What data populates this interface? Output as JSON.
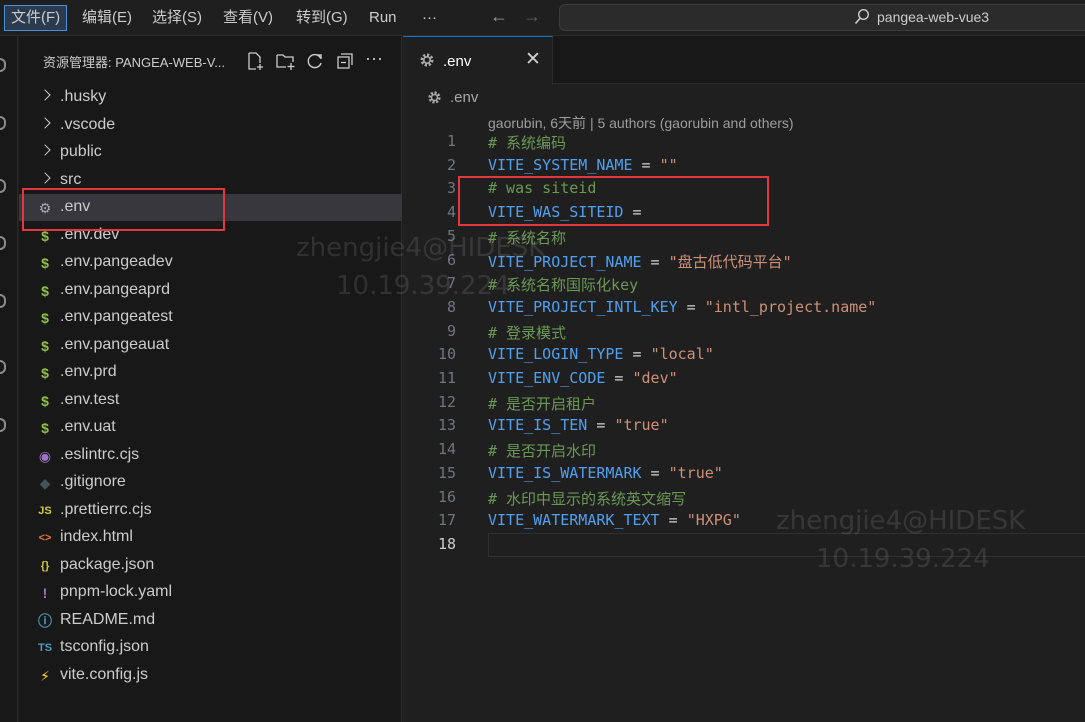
{
  "menu": {
    "file": "文件(F)",
    "edit": "编辑(E)",
    "selection": "选择(S)",
    "view": "查看(V)",
    "goto": "转到(G)",
    "run": "Run",
    "more": "···"
  },
  "search": {
    "text": "pangea-web-vue3"
  },
  "sidebar": {
    "title": "资源管理器: PANGEA-WEB-V...",
    "items": [
      {
        "label": ".husky",
        "type": "folder"
      },
      {
        "label": ".vscode",
        "type": "folder"
      },
      {
        "label": "public",
        "type": "folder"
      },
      {
        "label": "src",
        "type": "folder"
      },
      {
        "label": ".env",
        "type": "gear"
      },
      {
        "label": ".env.dev",
        "type": "dollar"
      },
      {
        "label": ".env.pangeadev",
        "type": "dollar"
      },
      {
        "label": ".env.pangeaprd",
        "type": "dollar"
      },
      {
        "label": ".env.pangeatest",
        "type": "dollar"
      },
      {
        "label": ".env.pangeauat",
        "type": "dollar"
      },
      {
        "label": ".env.prd",
        "type": "dollar"
      },
      {
        "label": ".env.test",
        "type": "dollar"
      },
      {
        "label": ".env.uat",
        "type": "dollar"
      },
      {
        "label": ".eslintrc.cjs",
        "type": "eslint"
      },
      {
        "label": ".gitignore",
        "type": "git"
      },
      {
        "label": ".prettierrc.cjs",
        "type": "js"
      },
      {
        "label": "index.html",
        "type": "html"
      },
      {
        "label": "package.json",
        "type": "json"
      },
      {
        "label": "pnpm-lock.yaml",
        "type": "yaml"
      },
      {
        "label": "README.md",
        "type": "info"
      },
      {
        "label": "tsconfig.json",
        "type": "ts"
      },
      {
        "label": "vite.config.js",
        "type": "vite"
      }
    ]
  },
  "editor": {
    "tab_label": ".env",
    "tab_close": "✕",
    "breadcrumb": ".env",
    "blame": "gaorubin, 6天前 | 5 authors (gaorubin and others)",
    "lines": [
      {
        "n": "1",
        "comment": "# 系统编码"
      },
      {
        "n": "2",
        "key": "VITE_SYSTEM_NAME",
        "op": " = ",
        "str": "\"\""
      },
      {
        "n": "3",
        "comment": "# was siteid"
      },
      {
        "n": "4",
        "key": "VITE_WAS_SITEID",
        "op": " =",
        "str": ""
      },
      {
        "n": "5",
        "comment": "# 系统名称"
      },
      {
        "n": "6",
        "key": "VITE_PROJECT_NAME",
        "op": " = ",
        "str": "\"盘古低代码平台\""
      },
      {
        "n": "7",
        "comment": "# 系统名称国际化key"
      },
      {
        "n": "8",
        "key": "VITE_PROJECT_INTL_KEY",
        "op": " = ",
        "str": "\"intl_project.name\""
      },
      {
        "n": "9",
        "comment": "# 登录模式"
      },
      {
        "n": "10",
        "key": "VITE_LOGIN_TYPE",
        "op": " = ",
        "str": "\"local\""
      },
      {
        "n": "11",
        "key": "VITE_ENV_CODE",
        "op": " = ",
        "str": "\"dev\""
      },
      {
        "n": "12",
        "comment": "# 是否开启租户"
      },
      {
        "n": "13",
        "key": "VITE_IS_TEN",
        "op": " = ",
        "str": "\"true\""
      },
      {
        "n": "14",
        "comment": "# 是否开启水印"
      },
      {
        "n": "15",
        "key": "VITE_IS_WATERMARK",
        "op": " = ",
        "str": "\"true\""
      },
      {
        "n": "16",
        "comment": "# 水印中显示的系统英文缩写"
      },
      {
        "n": "17",
        "key": "VITE_WATERMARK_TEXT",
        "op": " = ",
        "str": "\"HXPG\""
      },
      {
        "n": "18"
      }
    ]
  },
  "watermark": {
    "user": "zhengjie4@HIDESK",
    "ip": "10.19.39.224"
  },
  "colors": {
    "accent": "#0078d4",
    "highlight_box": "#e0383e"
  }
}
